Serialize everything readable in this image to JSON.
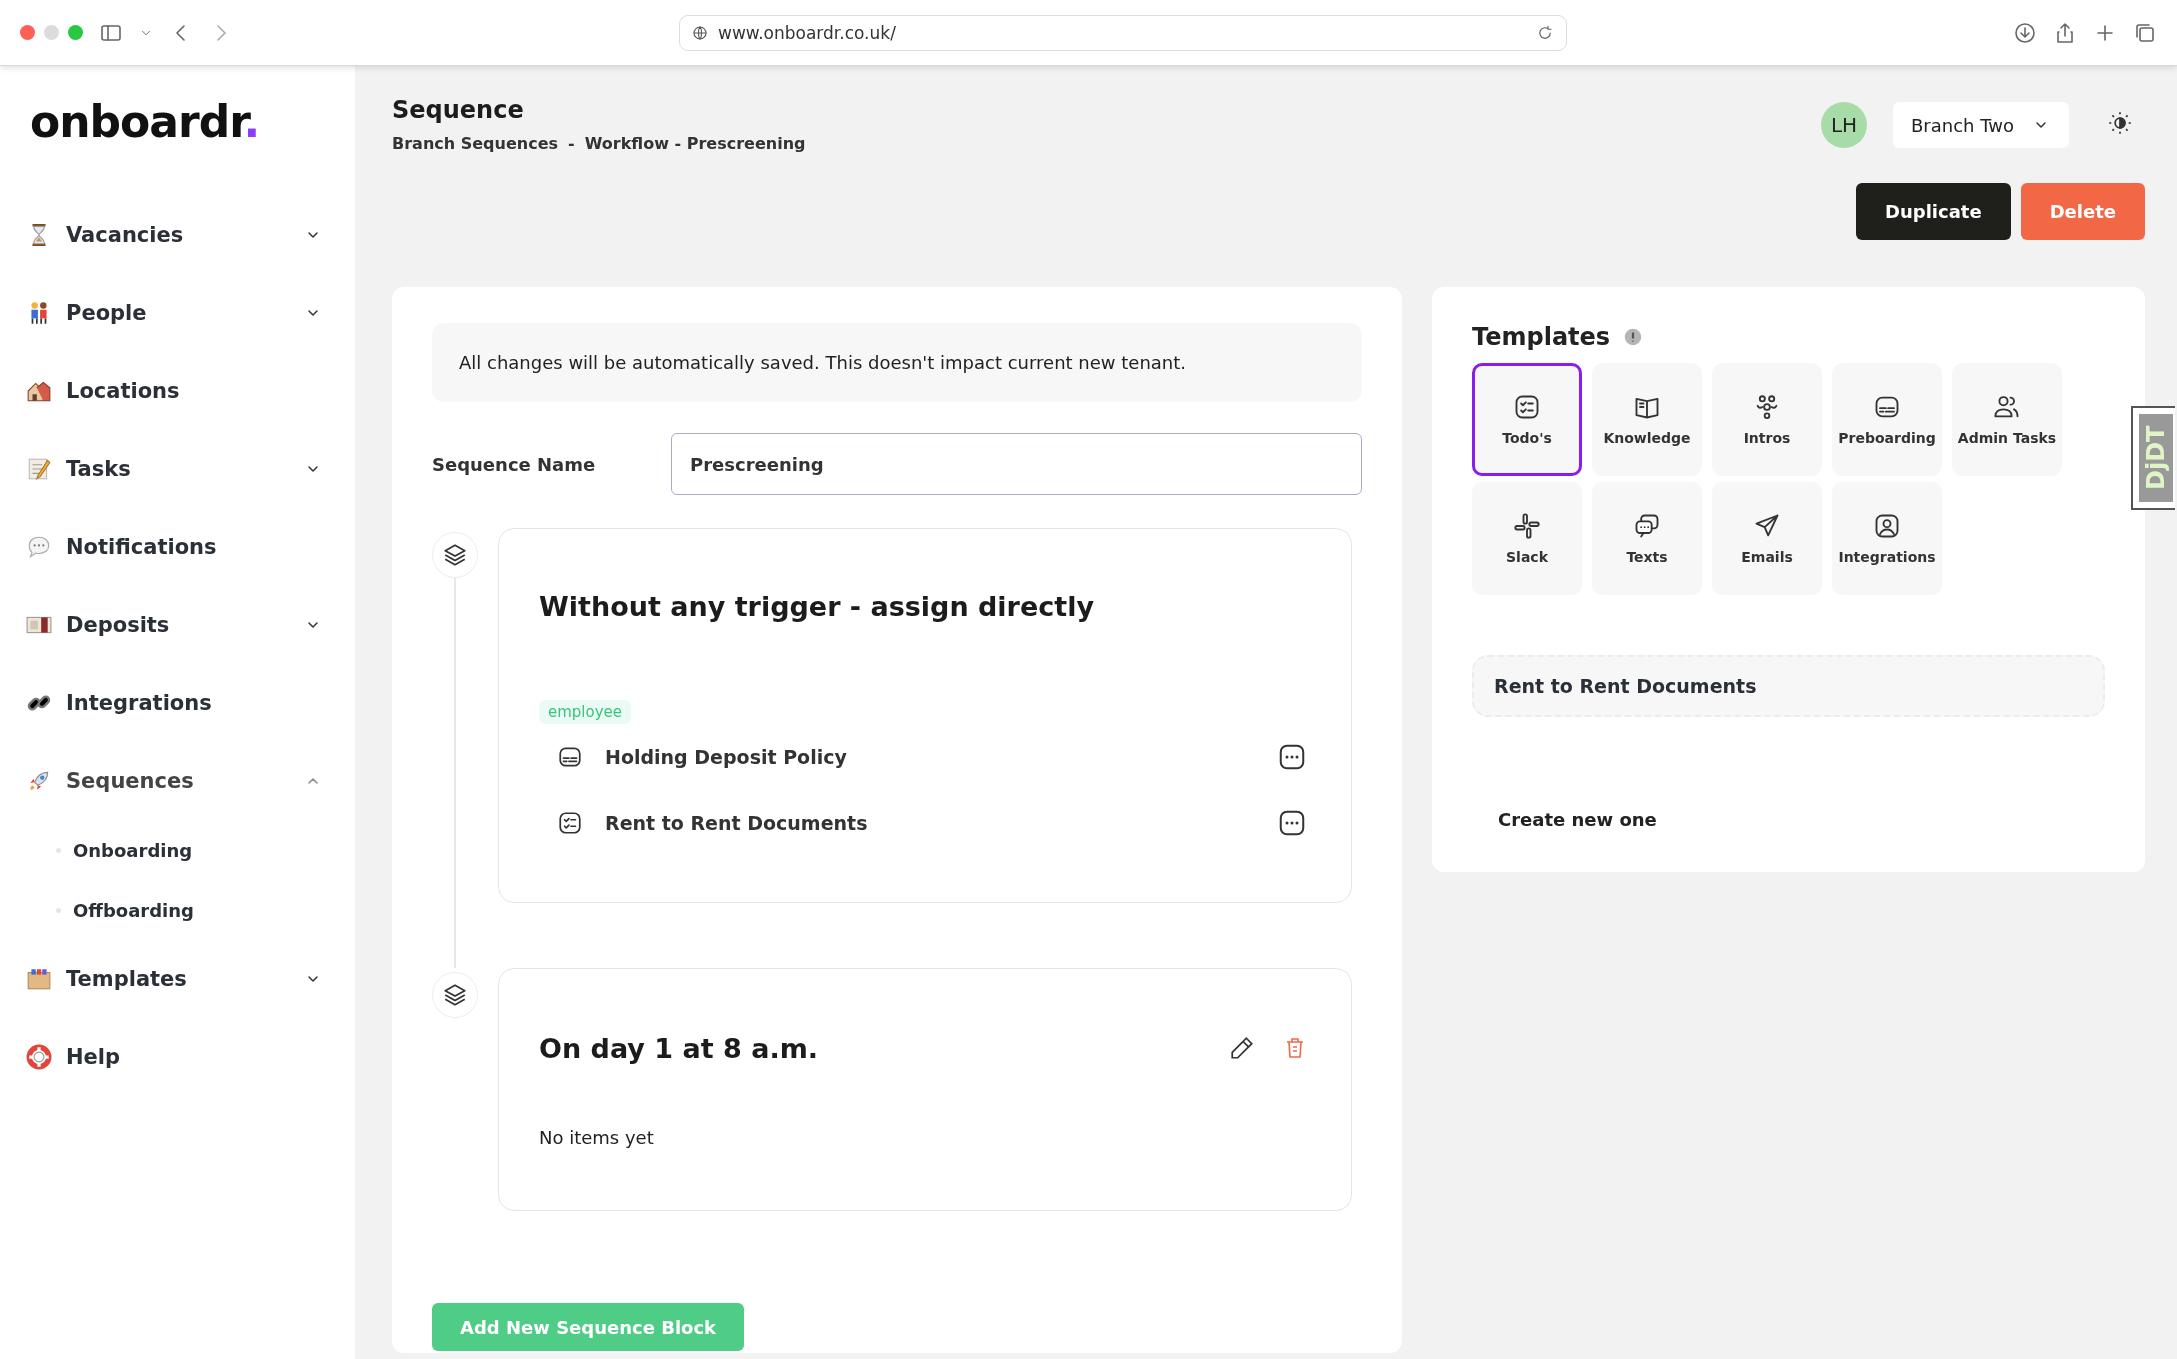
{
  "browser": {
    "url": "www.onboardr.co.uk/"
  },
  "sidebar": {
    "logo": "onboardr",
    "logo_dot": ".",
    "items": [
      {
        "label": "Vacancies",
        "kind": "group",
        "expanded": false
      },
      {
        "label": "People",
        "kind": "group",
        "expanded": false
      },
      {
        "label": "Locations",
        "kind": "link"
      },
      {
        "label": "Tasks",
        "kind": "group",
        "expanded": false
      },
      {
        "label": "Notifications",
        "kind": "link"
      },
      {
        "label": "Deposits",
        "kind": "group",
        "expanded": false
      },
      {
        "label": "Integrations",
        "kind": "link"
      },
      {
        "label": "Sequences",
        "kind": "group",
        "expanded": true,
        "children": [
          {
            "label": "Onboarding"
          },
          {
            "label": "Offboarding"
          }
        ]
      },
      {
        "label": "Templates",
        "kind": "group",
        "expanded": false
      },
      {
        "label": "Help",
        "kind": "link"
      }
    ]
  },
  "header": {
    "title": "Sequence",
    "breadcrumb": [
      "Branch Sequences",
      "-",
      "Workflow - Prescreening"
    ],
    "avatar": "LH",
    "branch": "Branch Two",
    "actions": [
      {
        "label": "Duplicate",
        "kind": "dark"
      },
      {
        "label": "Delete",
        "kind": "danger"
      }
    ]
  },
  "sequence": {
    "notice": "All changes will be automatically saved. This doesn't impact current new tenant.",
    "name_label": "Sequence Name",
    "name_value": "Prescreening",
    "blocks": [
      {
        "title": "Without any trigger - assign directly",
        "editable": false,
        "tag": "employee",
        "items": [
          {
            "label": "Holding Deposit Policy"
          },
          {
            "label": "Rent to Rent Documents"
          }
        ]
      },
      {
        "title": "On day 1 at 8 a.m.",
        "editable": true,
        "empty_text": "No items yet"
      }
    ],
    "add_button": "Add New Sequence Block"
  },
  "templates": {
    "title": "Templates",
    "tiles": [
      {
        "label": "Todo's",
        "selected": true
      },
      {
        "label": "Knowledge",
        "selected": false
      },
      {
        "label": "Intros",
        "selected": false
      },
      {
        "label": "Preboarding",
        "selected": false
      },
      {
        "label": "Admin Tasks",
        "selected": false
      },
      {
        "label": "Slack",
        "selected": false
      },
      {
        "label": "Texts",
        "selected": false
      },
      {
        "label": "Emails",
        "selected": false
      },
      {
        "label": "Integrations",
        "selected": false
      }
    ],
    "entries": [
      "Rent to Rent Documents"
    ],
    "create_link": "Create new one"
  },
  "debug_toolbar": "DjDT"
}
